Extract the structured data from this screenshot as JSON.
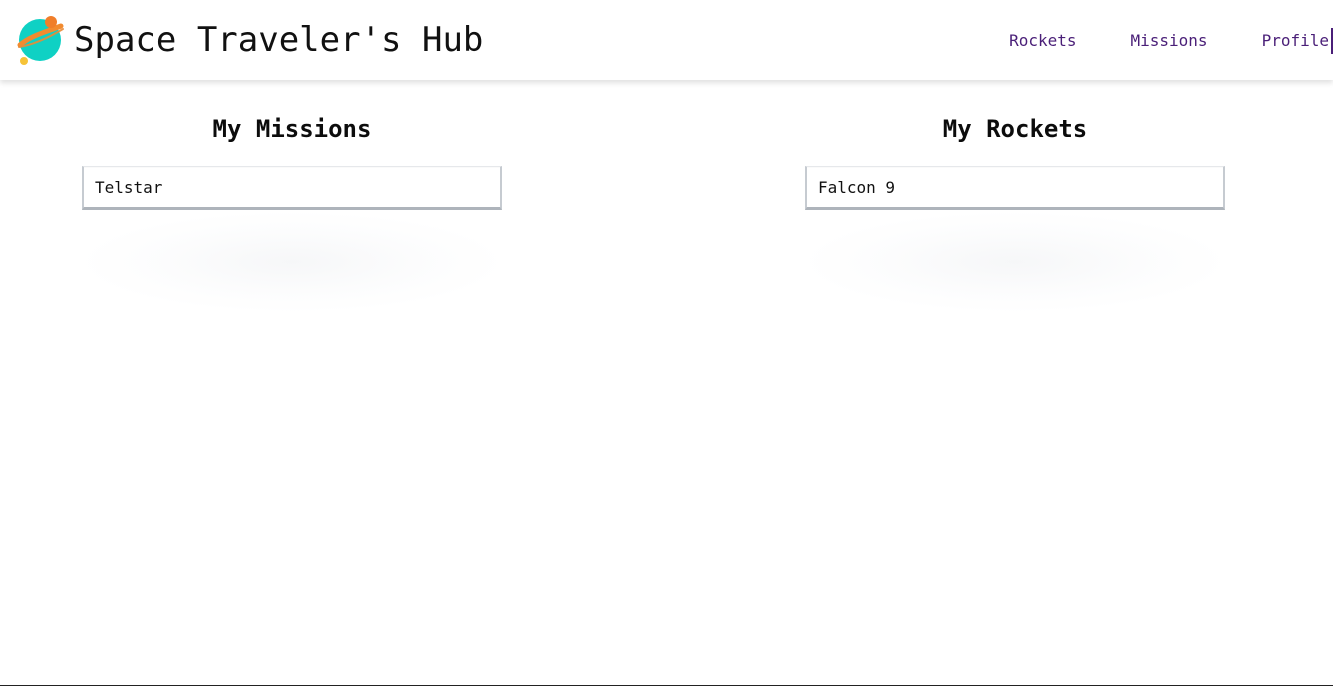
{
  "app": {
    "title": "Space Traveler's Hub",
    "logo_icon": "planet-icon"
  },
  "nav": {
    "items": [
      {
        "label": "Rockets"
      },
      {
        "label": "Missions"
      },
      {
        "label": "Profile"
      }
    ]
  },
  "profile": {
    "missions": {
      "title": "My Missions",
      "items": [
        "Telstar"
      ]
    },
    "rockets": {
      "title": "My Rockets",
      "items": [
        "Falcon 9"
      ]
    }
  },
  "colors": {
    "nav_link": "#4a1f78",
    "planet_body": "#0fd1c4",
    "planet_ring": "#f28b2f",
    "moon_large": "#f07e2a",
    "moon_small": "#f6c338",
    "text": "#111111"
  }
}
